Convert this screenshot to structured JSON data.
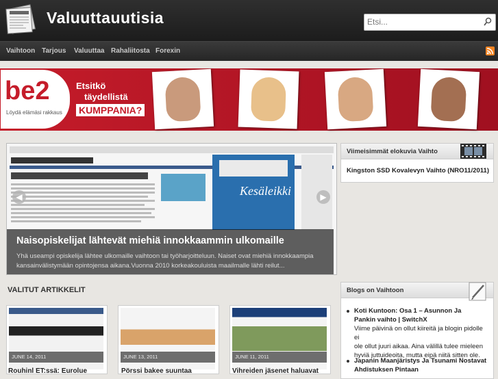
{
  "header": {
    "title": "Valuuttauutisia",
    "logo_icon": "newspaper-icon"
  },
  "search": {
    "placeholder": "Etsi...",
    "icon": "search-icon"
  },
  "nav": {
    "items": [
      "Vaihtoon",
      "Tarjous",
      "Valuuttaa",
      "Rahaliitosta",
      "Forexin"
    ],
    "rss_icon": "rss-icon"
  },
  "banner": {
    "brand": "be2",
    "slogan": "Löydä elämäsi rakkaus",
    "line1": "Etsitkö",
    "line2": "täydellistä",
    "line3": "KUMPPANIA?"
  },
  "slider": {
    "title": "Naisopiskelijat lähtevät miehiä innokkaammin ulkomaille",
    "text": "Yhä useampi opiskelija lähtee ulkomaille vaihtoon tai työharjoitteluun. Naiset ovat miehiä innokkaampia kansainvälistymään opintojensa aikana.Vuonna 2010 korkeakouluista maailmalle lähti reilut...",
    "prev_icon": "arrow-left-icon",
    "next_icon": "arrow-right-icon"
  },
  "featured": {
    "heading": "VALITUT ARTIKKELIT",
    "items": [
      {
        "date": "JUNE 14, 2011",
        "title": "Rouhinl ET:ssä: Eurolue"
      },
      {
        "date": "JUNE 13, 2011",
        "title": "Pörssi bakee suuntaa"
      },
      {
        "date": "JUNE 11, 2011",
        "title": "Vihreiden jäsenet haluavat"
      }
    ]
  },
  "sidebar": {
    "widget1": {
      "title": "Viimeisimmät elokuvia Vaihto",
      "item": "Kingston SSD Kovalevyn Vaihto (NRO11/2011)"
    },
    "widget2": {
      "title": "Blogs on Vaihtoon",
      "posts": [
        {
          "title1": "Koti Kuntoon: Osa 1 – Asunnon Ja",
          "title2": "Pankin vaihto | SwitchX",
          "text": [
            "Viime päivinä on ollut kiireitä ja blogin pidolle ei",
            "ole ollut juuri aikaa. Aina välillä tulee mieleen",
            "hyviä juttuideoita, mutta eipä niitä sitten ole."
          ]
        },
        {
          "title1": "Japanin Maanjäristys Ja Tsunami Nostavat",
          "title2": "Ahdistuksen Pintaan"
        }
      ]
    }
  }
}
